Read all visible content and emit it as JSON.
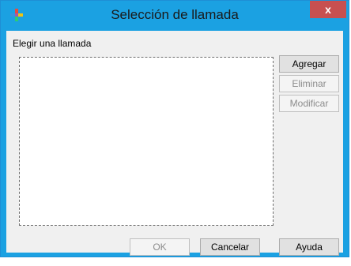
{
  "window": {
    "title": "Selección de llamada",
    "close_label": "x",
    "icon": "app-multicolor-icon"
  },
  "main": {
    "list_label": "Elegir una llamada",
    "list_items": []
  },
  "side_buttons": {
    "add": "Agregar",
    "remove": "Eliminar",
    "modify": "Modificar"
  },
  "footer_buttons": {
    "ok": "OK",
    "cancel": "Cancelar",
    "help": "Ayuda"
  },
  "colors": {
    "titlebar": "#1ba1e2",
    "close": "#c75050",
    "client": "#f0f0f0"
  }
}
